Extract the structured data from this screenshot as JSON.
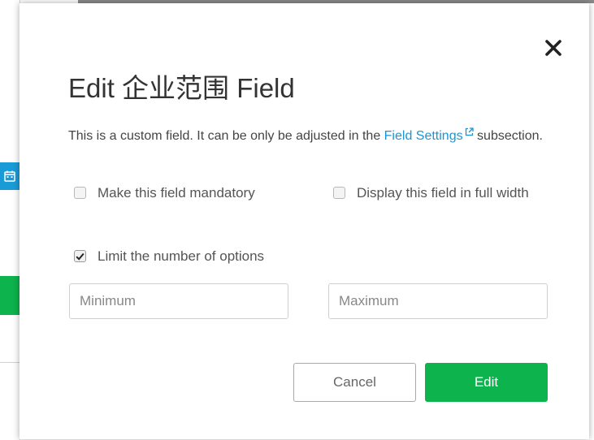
{
  "background": {
    "calendar_icon": "calendar-icon",
    "accent_blue": "#1a9bd7",
    "accent_green": "#0db34c"
  },
  "modal": {
    "close_icon": "close-icon",
    "title": "Edit 企业范围 Field",
    "help": {
      "prefix": "This is a custom field. It can be only be adjusted in the ",
      "link_text": "Field Settings",
      "link_icon": "external-link-icon",
      "suffix": " subsection."
    },
    "options": {
      "mandatory": {
        "label": "Make this field mandatory",
        "checked": false
      },
      "full_width": {
        "label": "Display this field in full width",
        "checked": false
      },
      "limit_options": {
        "label": "Limit the number of options",
        "checked": true
      }
    },
    "inputs": {
      "minimum": {
        "placeholder": "Minimum",
        "value": ""
      },
      "maximum": {
        "placeholder": "Maximum",
        "value": ""
      }
    },
    "buttons": {
      "cancel": "Cancel",
      "edit": "Edit"
    },
    "colors": {
      "link": "#1a95d3",
      "primary": "#0db34c",
      "text": "#333333"
    }
  }
}
